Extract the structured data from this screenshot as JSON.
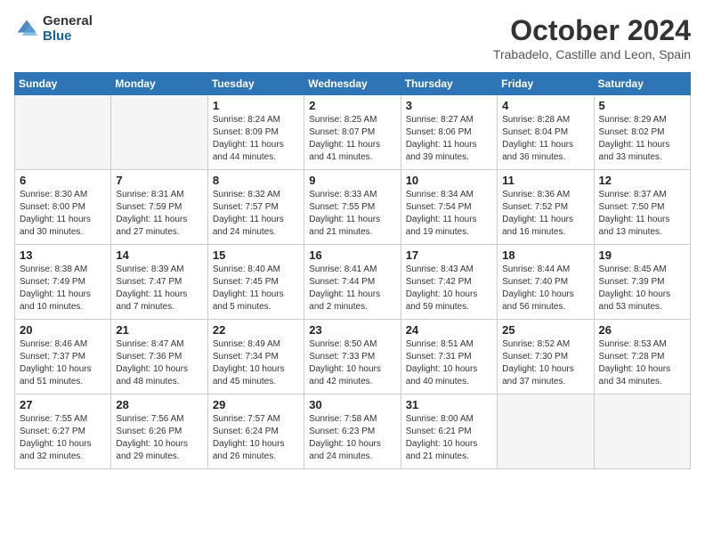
{
  "header": {
    "logo_general": "General",
    "logo_blue": "Blue",
    "month": "October 2024",
    "location": "Trabadelo, Castille and Leon, Spain"
  },
  "days_of_week": [
    "Sunday",
    "Monday",
    "Tuesday",
    "Wednesday",
    "Thursday",
    "Friday",
    "Saturday"
  ],
  "weeks": [
    [
      {
        "day": "",
        "empty": true
      },
      {
        "day": "",
        "empty": true
      },
      {
        "day": "1",
        "sunrise": "Sunrise: 8:24 AM",
        "sunset": "Sunset: 8:09 PM",
        "daylight": "Daylight: 11 hours and 44 minutes."
      },
      {
        "day": "2",
        "sunrise": "Sunrise: 8:25 AM",
        "sunset": "Sunset: 8:07 PM",
        "daylight": "Daylight: 11 hours and 41 minutes."
      },
      {
        "day": "3",
        "sunrise": "Sunrise: 8:27 AM",
        "sunset": "Sunset: 8:06 PM",
        "daylight": "Daylight: 11 hours and 39 minutes."
      },
      {
        "day": "4",
        "sunrise": "Sunrise: 8:28 AM",
        "sunset": "Sunset: 8:04 PM",
        "daylight": "Daylight: 11 hours and 36 minutes."
      },
      {
        "day": "5",
        "sunrise": "Sunrise: 8:29 AM",
        "sunset": "Sunset: 8:02 PM",
        "daylight": "Daylight: 11 hours and 33 minutes."
      }
    ],
    [
      {
        "day": "6",
        "sunrise": "Sunrise: 8:30 AM",
        "sunset": "Sunset: 8:00 PM",
        "daylight": "Daylight: 11 hours and 30 minutes."
      },
      {
        "day": "7",
        "sunrise": "Sunrise: 8:31 AM",
        "sunset": "Sunset: 7:59 PM",
        "daylight": "Daylight: 11 hours and 27 minutes."
      },
      {
        "day": "8",
        "sunrise": "Sunrise: 8:32 AM",
        "sunset": "Sunset: 7:57 PM",
        "daylight": "Daylight: 11 hours and 24 minutes."
      },
      {
        "day": "9",
        "sunrise": "Sunrise: 8:33 AM",
        "sunset": "Sunset: 7:55 PM",
        "daylight": "Daylight: 11 hours and 21 minutes."
      },
      {
        "day": "10",
        "sunrise": "Sunrise: 8:34 AM",
        "sunset": "Sunset: 7:54 PM",
        "daylight": "Daylight: 11 hours and 19 minutes."
      },
      {
        "day": "11",
        "sunrise": "Sunrise: 8:36 AM",
        "sunset": "Sunset: 7:52 PM",
        "daylight": "Daylight: 11 hours and 16 minutes."
      },
      {
        "day": "12",
        "sunrise": "Sunrise: 8:37 AM",
        "sunset": "Sunset: 7:50 PM",
        "daylight": "Daylight: 11 hours and 13 minutes."
      }
    ],
    [
      {
        "day": "13",
        "sunrise": "Sunrise: 8:38 AM",
        "sunset": "Sunset: 7:49 PM",
        "daylight": "Daylight: 11 hours and 10 minutes."
      },
      {
        "day": "14",
        "sunrise": "Sunrise: 8:39 AM",
        "sunset": "Sunset: 7:47 PM",
        "daylight": "Daylight: 11 hours and 7 minutes."
      },
      {
        "day": "15",
        "sunrise": "Sunrise: 8:40 AM",
        "sunset": "Sunset: 7:45 PM",
        "daylight": "Daylight: 11 hours and 5 minutes."
      },
      {
        "day": "16",
        "sunrise": "Sunrise: 8:41 AM",
        "sunset": "Sunset: 7:44 PM",
        "daylight": "Daylight: 11 hours and 2 minutes."
      },
      {
        "day": "17",
        "sunrise": "Sunrise: 8:43 AM",
        "sunset": "Sunset: 7:42 PM",
        "daylight": "Daylight: 10 hours and 59 minutes."
      },
      {
        "day": "18",
        "sunrise": "Sunrise: 8:44 AM",
        "sunset": "Sunset: 7:40 PM",
        "daylight": "Daylight: 10 hours and 56 minutes."
      },
      {
        "day": "19",
        "sunrise": "Sunrise: 8:45 AM",
        "sunset": "Sunset: 7:39 PM",
        "daylight": "Daylight: 10 hours and 53 minutes."
      }
    ],
    [
      {
        "day": "20",
        "sunrise": "Sunrise: 8:46 AM",
        "sunset": "Sunset: 7:37 PM",
        "daylight": "Daylight: 10 hours and 51 minutes."
      },
      {
        "day": "21",
        "sunrise": "Sunrise: 8:47 AM",
        "sunset": "Sunset: 7:36 PM",
        "daylight": "Daylight: 10 hours and 48 minutes."
      },
      {
        "day": "22",
        "sunrise": "Sunrise: 8:49 AM",
        "sunset": "Sunset: 7:34 PM",
        "daylight": "Daylight: 10 hours and 45 minutes."
      },
      {
        "day": "23",
        "sunrise": "Sunrise: 8:50 AM",
        "sunset": "Sunset: 7:33 PM",
        "daylight": "Daylight: 10 hours and 42 minutes."
      },
      {
        "day": "24",
        "sunrise": "Sunrise: 8:51 AM",
        "sunset": "Sunset: 7:31 PM",
        "daylight": "Daylight: 10 hours and 40 minutes."
      },
      {
        "day": "25",
        "sunrise": "Sunrise: 8:52 AM",
        "sunset": "Sunset: 7:30 PM",
        "daylight": "Daylight: 10 hours and 37 minutes."
      },
      {
        "day": "26",
        "sunrise": "Sunrise: 8:53 AM",
        "sunset": "Sunset: 7:28 PM",
        "daylight": "Daylight: 10 hours and 34 minutes."
      }
    ],
    [
      {
        "day": "27",
        "sunrise": "Sunrise: 7:55 AM",
        "sunset": "Sunset: 6:27 PM",
        "daylight": "Daylight: 10 hours and 32 minutes."
      },
      {
        "day": "28",
        "sunrise": "Sunrise: 7:56 AM",
        "sunset": "Sunset: 6:26 PM",
        "daylight": "Daylight: 10 hours and 29 minutes."
      },
      {
        "day": "29",
        "sunrise": "Sunrise: 7:57 AM",
        "sunset": "Sunset: 6:24 PM",
        "daylight": "Daylight: 10 hours and 26 minutes."
      },
      {
        "day": "30",
        "sunrise": "Sunrise: 7:58 AM",
        "sunset": "Sunset: 6:23 PM",
        "daylight": "Daylight: 10 hours and 24 minutes."
      },
      {
        "day": "31",
        "sunrise": "Sunrise: 8:00 AM",
        "sunset": "Sunset: 6:21 PM",
        "daylight": "Daylight: 10 hours and 21 minutes."
      },
      {
        "day": "",
        "empty": true
      },
      {
        "day": "",
        "empty": true
      }
    ]
  ]
}
